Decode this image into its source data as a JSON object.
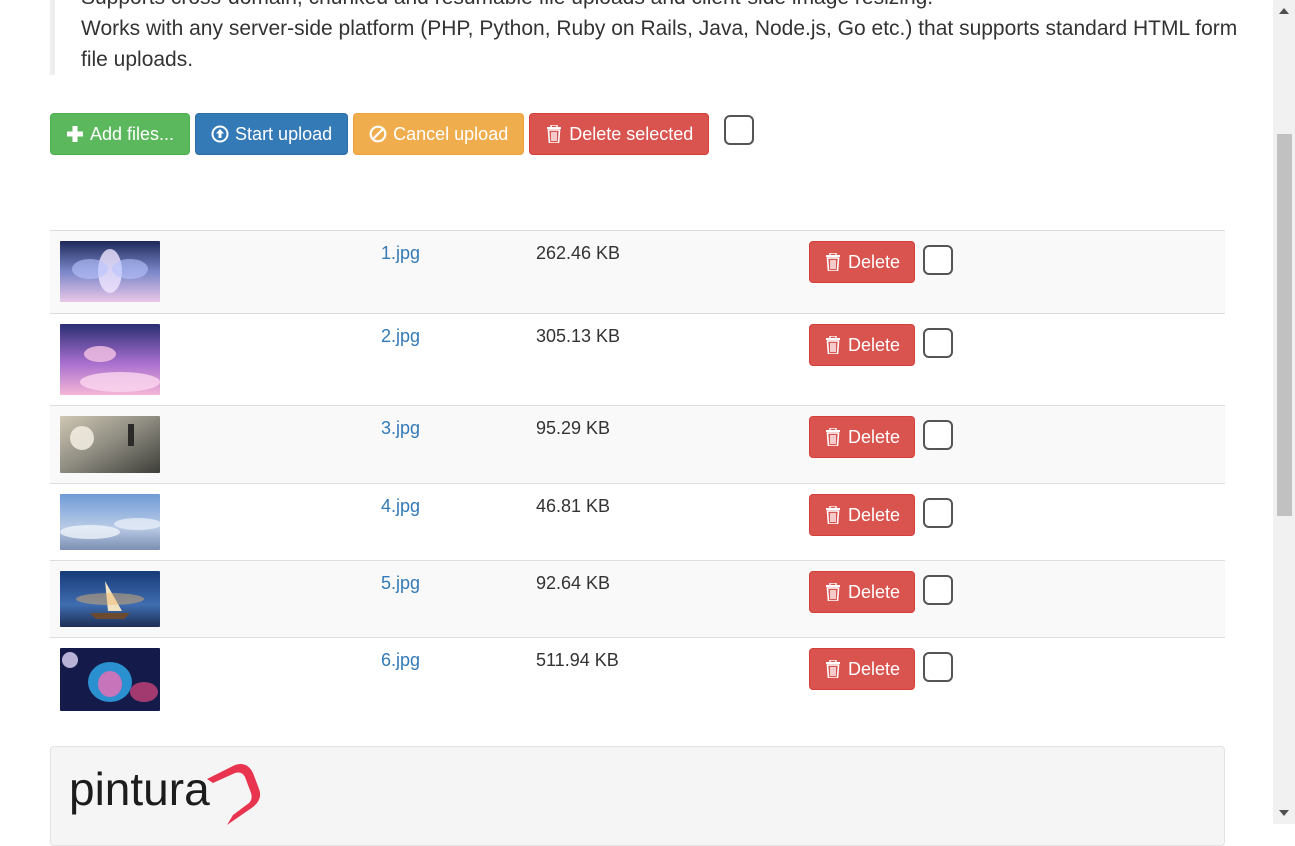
{
  "description": {
    "line1": "Supports cross-domain, chunked and resumable file uploads and client-side image resizing.",
    "line2": "Works with any server-side platform (PHP, Python, Ruby on Rails, Java, Node.js, Go etc.) that supports standard HTML form file uploads."
  },
  "toolbar": {
    "add_label": "Add files...",
    "start_label": "Start upload",
    "cancel_label": "Cancel upload",
    "delete_label": "Delete selected"
  },
  "files": [
    {
      "name": "1.jpg",
      "size": "262.46 KB",
      "delete_label": "Delete"
    },
    {
      "name": "2.jpg",
      "size": "305.13 KB",
      "delete_label": "Delete"
    },
    {
      "name": "3.jpg",
      "size": "95.29 KB",
      "delete_label": "Delete"
    },
    {
      "name": "4.jpg",
      "size": "46.81 KB",
      "delete_label": "Delete"
    },
    {
      "name": "5.jpg",
      "size": "92.64 KB",
      "delete_label": "Delete"
    },
    {
      "name": "6.jpg",
      "size": "511.94 KB",
      "delete_label": "Delete"
    }
  ],
  "promo": {
    "logo_text": "pintura"
  },
  "colors": {
    "success": "#5cb85c",
    "primary": "#337ab7",
    "warning": "#f0ad4e",
    "danger": "#d9534f",
    "link": "#337ab7"
  },
  "icons": {
    "add": "plus-icon",
    "start": "upload-circle-icon",
    "cancel": "ban-icon",
    "delete": "trash-icon"
  }
}
